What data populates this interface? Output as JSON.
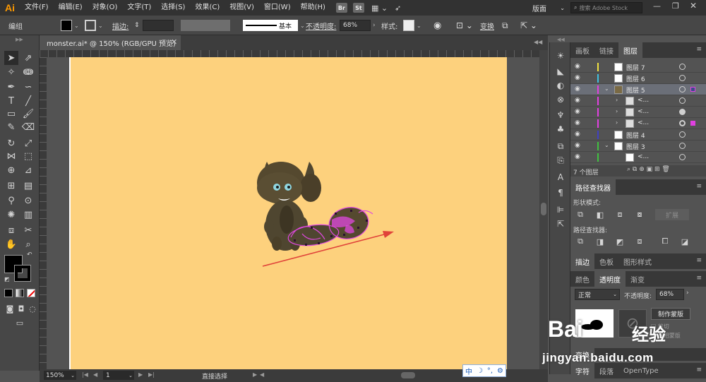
{
  "menubar": {
    "logo": "Ai",
    "items": [
      "文件(F)",
      "编辑(E)",
      "对象(O)",
      "文字(T)",
      "选择(S)",
      "效果(C)",
      "视图(V)",
      "窗口(W)",
      "帮助(H)"
    ],
    "bridge": "Br",
    "stock_badge": "St",
    "workspace": "版面",
    "search_placeholder": "搜索 Adobe Stock",
    "min": "—",
    "max": "❐",
    "close": "✕"
  },
  "control": {
    "selection_label": "编组",
    "stroke_label": "描边:",
    "stroke_style": "基本",
    "opacity_label": "不透明度:",
    "opacity_value": "68%",
    "style_label": "样式:",
    "transform_label": "变换"
  },
  "document": {
    "tab_title": "monster.ai* @ 150% (RGB/GPU 预览)",
    "tab_close": "✕",
    "artboard_color": "#fdd17d"
  },
  "status": {
    "zoom": "150%",
    "page": "1",
    "tool": "直接选择"
  },
  "layers": {
    "tabs": [
      "画板",
      "链接",
      "图层"
    ],
    "rows": [
      {
        "name": "图层 7",
        "color": "#f0e040",
        "indent": 0,
        "expand": "",
        "selected": false
      },
      {
        "name": "图层 6",
        "color": "#40c0e0",
        "indent": 0,
        "expand": "",
        "selected": false
      },
      {
        "name": "图层 5",
        "color": "#e040e0",
        "indent": 0,
        "expand": "⌄",
        "selected": true
      },
      {
        "name": "<...",
        "color": "#e040e0",
        "indent": 1,
        "expand": "›",
        "selected": false
      },
      {
        "name": "<...",
        "color": "#e040e0",
        "indent": 1,
        "expand": "›",
        "selected": false
      },
      {
        "name": "<...",
        "color": "#e040e0",
        "indent": 1,
        "expand": "›",
        "selected": false
      },
      {
        "name": "图层 4",
        "color": "#4040c0",
        "indent": 0,
        "expand": "",
        "selected": false
      },
      {
        "name": "图层 3",
        "color": "#40c040",
        "indent": 0,
        "expand": "⌄",
        "selected": false
      },
      {
        "name": "<...",
        "color": "#40c040",
        "indent": 1,
        "expand": "",
        "selected": false
      }
    ],
    "count": "7 个图层"
  },
  "pathfinder": {
    "title": "路径查找器",
    "shape_modes": "形状模式:",
    "expand": "扩展",
    "finders": "路径查找器:"
  },
  "stroke_panel": {
    "tabs": [
      "描边",
      "色板",
      "图形样式"
    ]
  },
  "transparency": {
    "tabs": [
      "颜色",
      "透明度",
      "渐变"
    ],
    "blend_mode": "正常",
    "opacity_label": "不透明度:",
    "opacity_value": "68%",
    "make_mask": "制作蒙版",
    "clip": "剪切",
    "invert": "反相蒙版"
  },
  "transform_panel": {
    "title": "变换"
  },
  "char_panel": {
    "tabs": [
      "字符",
      "段落",
      "OpenType"
    ]
  },
  "ime": {
    "lang": "中",
    "moon": "☽",
    "dot": "°,",
    "gear": "⚙"
  },
  "watermark": {
    "logo": "Bai",
    "brand": "经验",
    "url": "jingyan.baidu.com"
  }
}
